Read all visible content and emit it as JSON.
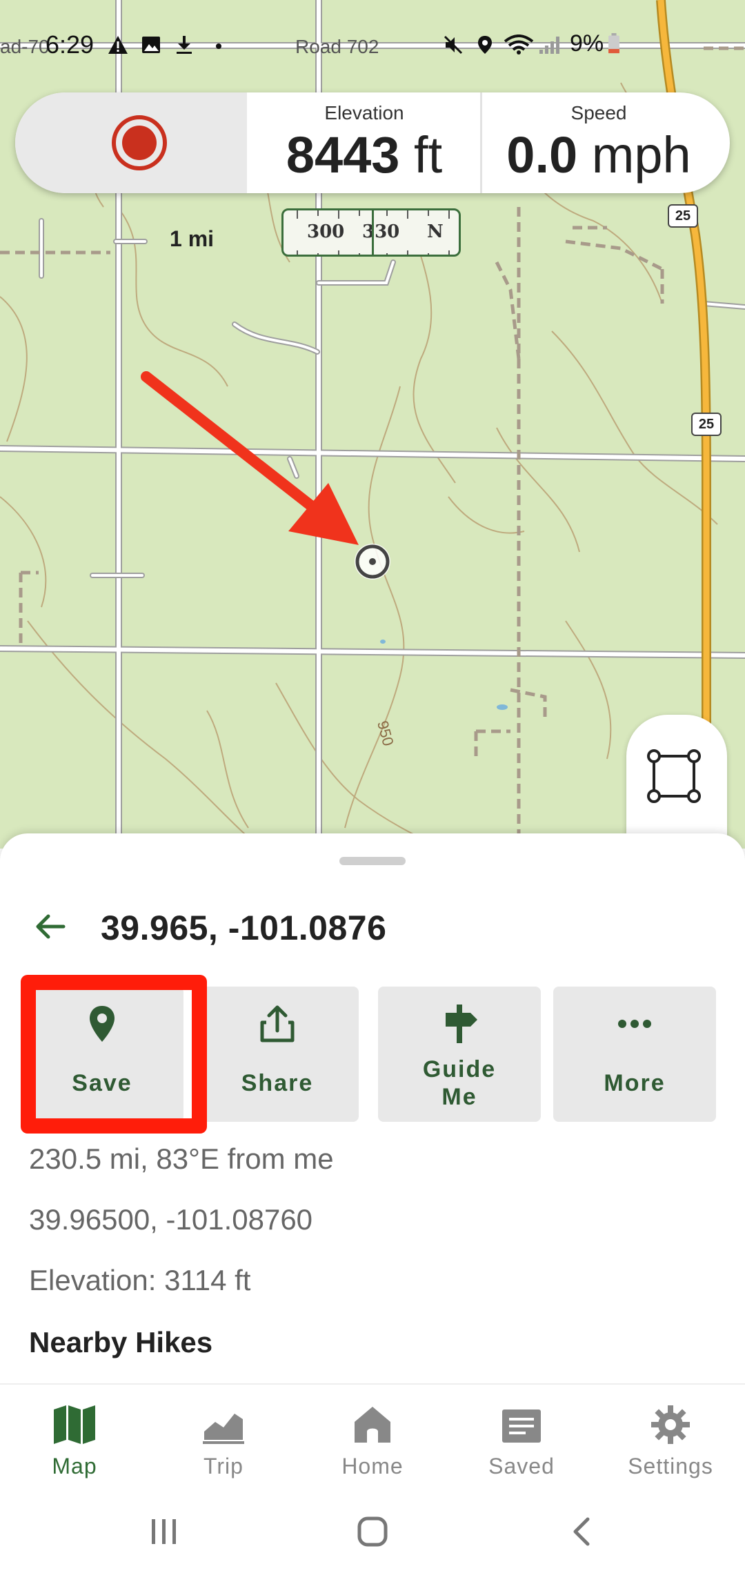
{
  "status_bar": {
    "road_left": "ad-70",
    "time": "6:29",
    "road_mid": "Road 702",
    "battery": "9%"
  },
  "stats": {
    "elevation_label": "Elevation",
    "elevation_value": "8443",
    "elevation_unit": " ft",
    "speed_label": "Speed",
    "speed_value": "0.0",
    "speed_unit": " mph"
  },
  "map": {
    "scale_label": "1 mi",
    "compass": {
      "left": "300",
      "mid": "330",
      "right": "N"
    },
    "highway_shield": "25",
    "contour_label": "950"
  },
  "sheet": {
    "coords_title": "39.965, -101.0876",
    "actions": [
      {
        "label": "Save",
        "icon": "map-pin-icon"
      },
      {
        "label": "Share",
        "icon": "share-icon"
      },
      {
        "label_line1": "Guide",
        "label_line2": "Me",
        "icon": "signpost-icon"
      },
      {
        "label": "More",
        "icon": "more-dots-icon"
      }
    ],
    "distance_info": "230.5 mi, 83°E from me",
    "precise_coords": "39.96500, -101.08760",
    "elevation_info": "Elevation: 3114 ft",
    "nearby_heading": "Nearby Hikes"
  },
  "nav": {
    "items": [
      {
        "label": "Map",
        "icon": "map-icon",
        "active": true
      },
      {
        "label": "Trip",
        "icon": "trip-chart-icon"
      },
      {
        "label": "Home",
        "icon": "home-icon"
      },
      {
        "label": "Saved",
        "icon": "saved-folder-icon"
      },
      {
        "label": "Settings",
        "icon": "gear-icon"
      }
    ]
  },
  "colors": {
    "brand_green": "#2f6b34",
    "record_red": "#c9301e",
    "highlight_red": "#ff1d0a",
    "map_background": "#d8e8bd"
  }
}
